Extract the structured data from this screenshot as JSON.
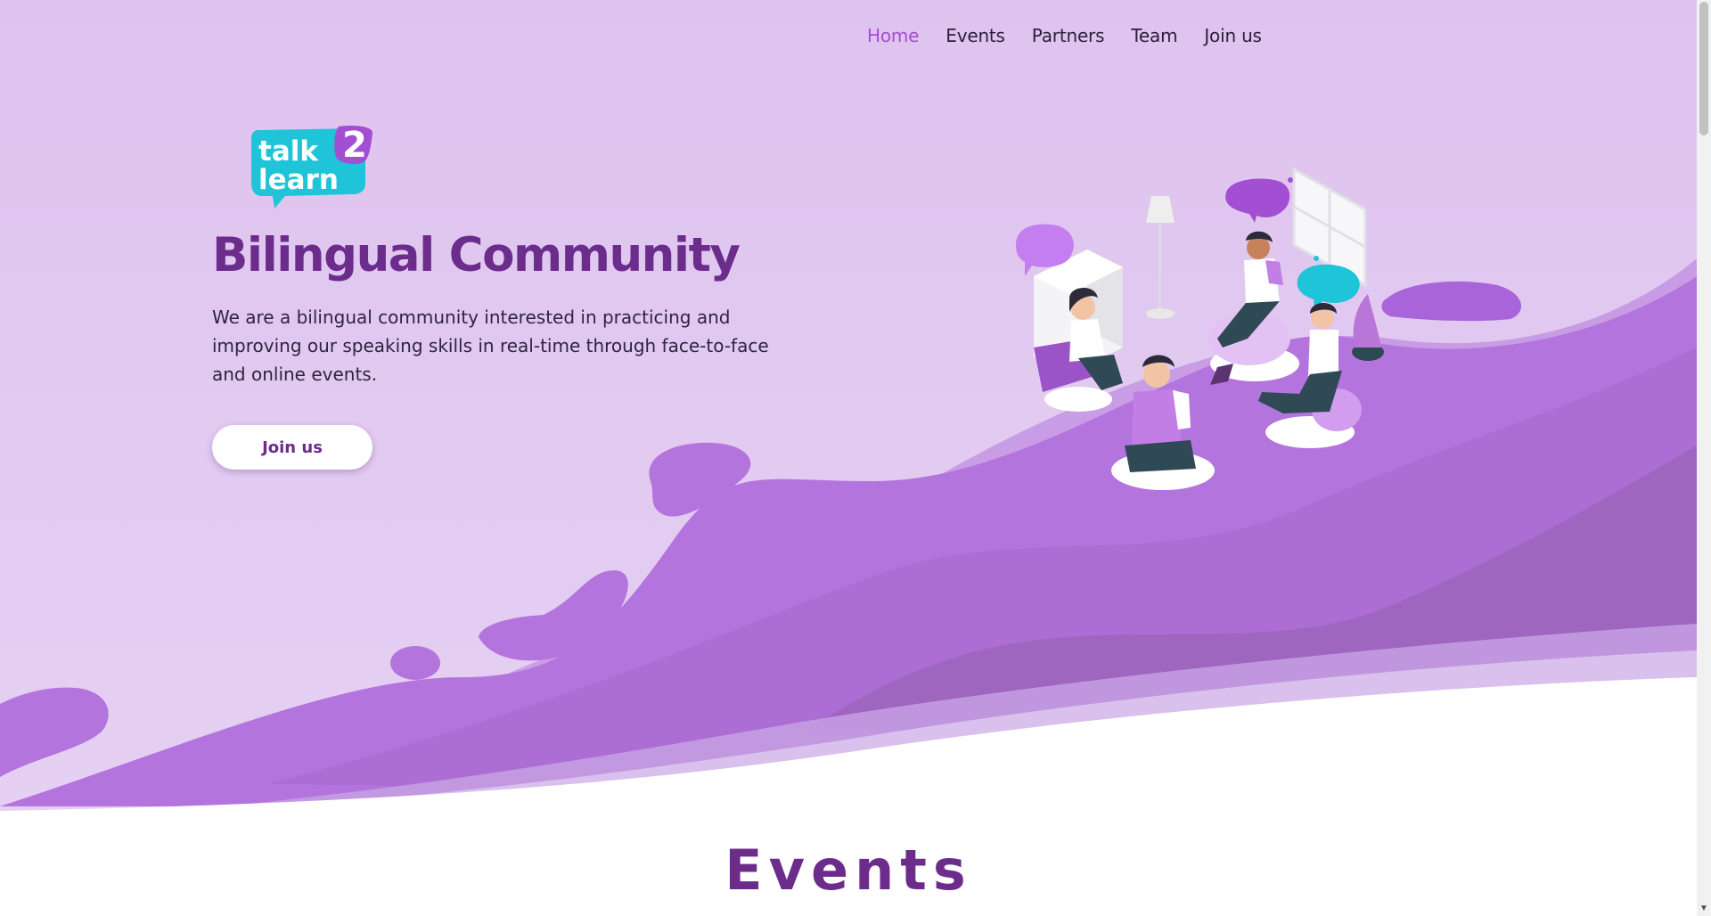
{
  "nav": {
    "items": [
      {
        "label": "Home",
        "active": true
      },
      {
        "label": "Events",
        "active": false
      },
      {
        "label": "Partners",
        "active": false
      },
      {
        "label": "Team",
        "active": false
      },
      {
        "label": "Join us",
        "active": false
      }
    ]
  },
  "logo": {
    "line1": "talk",
    "line2": "learn",
    "number": "2"
  },
  "hero": {
    "title": "Bilingual Community",
    "description": "We are a bilingual community interested in practicing and improving our speaking skills in real-time through face-to-face and online events.",
    "cta_label": "Join us"
  },
  "events": {
    "title": "Events"
  },
  "colors": {
    "brand_purple": "#6b2c8c",
    "accent_purple": "#a24fd3",
    "wave_purple": "#b478dd",
    "logo_teal": "#20c4d8"
  }
}
